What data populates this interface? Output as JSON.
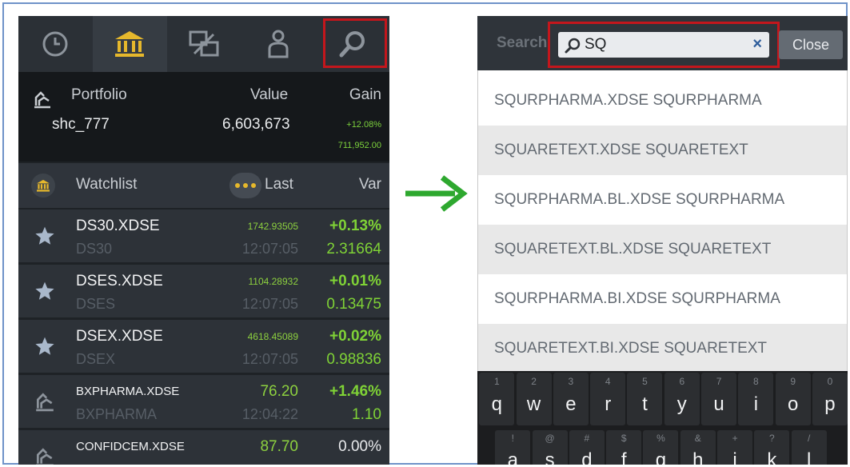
{
  "colors": {
    "highlight": "#c4161c",
    "arrow": "#2ea82f",
    "gold": "#e6b82c",
    "positive": "#7fd236",
    "frame": "#6f93c9"
  },
  "left_screen": {
    "tabs": [
      {
        "icon": "clock-icon"
      },
      {
        "icon": "bank-icon"
      },
      {
        "icon": "resize-icon"
      },
      {
        "icon": "user-icon"
      },
      {
        "icon": "search-icon"
      }
    ],
    "portfolio": {
      "label": "Portfolio",
      "value_header": "Value",
      "gain_header": "Gain",
      "name": "shc_777",
      "value": "6,603,673",
      "gain_pct": "+12.08%",
      "gain_abs": "711,952.00"
    },
    "watchlist": {
      "title": "Watchlist",
      "last_header": "Last",
      "var_header": "Var"
    },
    "rows": [
      {
        "symbol": "DS30.XDSE",
        "name": "DS30",
        "last": "1742.93505",
        "time": "12:07:05",
        "pct": "+0.13%",
        "change": "2.31664",
        "icon": "star-icon"
      },
      {
        "symbol": "DSES.XDSE",
        "name": "DSES",
        "last": "1104.28932",
        "time": "12:07:05",
        "pct": "+0.01%",
        "change": "0.13475",
        "icon": "star-icon"
      },
      {
        "symbol": "DSEX.XDSE",
        "name": "DSEX",
        "last": "4618.45089",
        "time": "12:07:05",
        "pct": "+0.02%",
        "change": "0.98836",
        "icon": "star-icon"
      },
      {
        "symbol": "BXPHARMA.XDSE",
        "name": "BXPHARMA",
        "last": "76.20",
        "time": "12:04:22",
        "pct": "+1.46%",
        "change": "1.10",
        "icon": "portfolio-icon"
      },
      {
        "symbol": "CONFIDCEM.XDSE",
        "name": "",
        "last": "87.70",
        "time": "",
        "pct": "0.00%",
        "change": "",
        "icon": "portfolio-icon"
      }
    ]
  },
  "right_screen": {
    "search_label": "Search",
    "search_value": "SQ",
    "clear_glyph": "×",
    "close_label": "Close",
    "results": [
      "SQURPHARMA.XDSE SQURPHARMA",
      "SQUARETEXT.XDSE SQUARETEXT",
      "SQURPHARMA.BL.XDSE SQURPHARMA",
      "SQUARETEXT.BL.XDSE SQUARETEXT",
      "SQURPHARMA.BI.XDSE SQURPHARMA",
      "SQUARETEXT.BI.XDSE SQUARETEXT"
    ],
    "keyboard": {
      "row1": [
        {
          "num": "1",
          "ch": "q"
        },
        {
          "num": "2",
          "ch": "w"
        },
        {
          "num": "3",
          "ch": "e"
        },
        {
          "num": "4",
          "ch": "r"
        },
        {
          "num": "5",
          "ch": "t"
        },
        {
          "num": "6",
          "ch": "y"
        },
        {
          "num": "7",
          "ch": "u"
        },
        {
          "num": "8",
          "ch": "i"
        },
        {
          "num": "9",
          "ch": "o"
        },
        {
          "num": "0",
          "ch": "p"
        }
      ],
      "row2": [
        {
          "num": "!",
          "ch": "a"
        },
        {
          "num": "@",
          "ch": "s"
        },
        {
          "num": "#",
          "ch": "d"
        },
        {
          "num": "$",
          "ch": "f"
        },
        {
          "num": "%",
          "ch": "g"
        },
        {
          "num": "&",
          "ch": "h"
        },
        {
          "num": "+",
          "ch": "j"
        },
        {
          "num": "?",
          "ch": "k"
        },
        {
          "num": "/",
          "ch": "l"
        }
      ]
    }
  }
}
